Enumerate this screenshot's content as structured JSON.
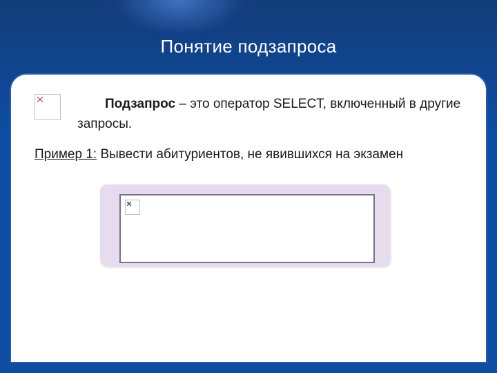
{
  "title": "Понятие подзапроса",
  "definition": {
    "term": "Подзапрос",
    "rest": " – это оператор SELECT, включенный в другие запросы."
  },
  "example": {
    "label": "Пример 1:",
    "text": " Вывести абитуриентов, не явившихся на экзамен"
  },
  "icons": {
    "broken1": "broken-image-placeholder",
    "broken2": "broken-image-placeholder"
  }
}
